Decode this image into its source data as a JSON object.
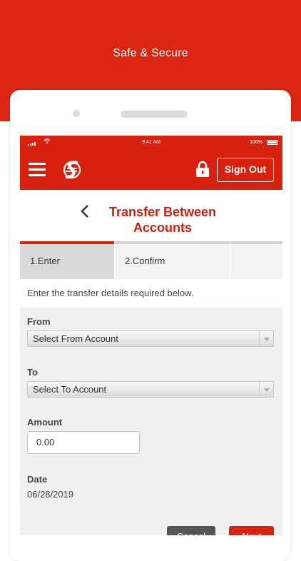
{
  "banner": {
    "tagline": "Safe & Secure"
  },
  "status_bar": {
    "time": "9:41 AM",
    "battery": "100%"
  },
  "app_bar": {
    "sign_out_label": "Sign Out"
  },
  "page": {
    "title_line1": "Transfer Between",
    "title_line2": "Accounts"
  },
  "steps": [
    {
      "label": "1.Enter",
      "active": true
    },
    {
      "label": "2.Confirm",
      "active": false
    },
    {
      "label": "",
      "active": false
    }
  ],
  "form": {
    "instructions": "Enter the transfer details required below.",
    "from_label": "From",
    "from_value": "Select From Account",
    "to_label": "To",
    "to_value": "Select To Account",
    "amount_label": "Amount",
    "amount_value": "0.00",
    "date_label": "Date",
    "date_value": "06/28/2019"
  },
  "actions": {
    "cancel_label": "Cancel",
    "next_label": "Next"
  },
  "colors": {
    "brand_red": "#d8220f",
    "title_red": "#c8200e",
    "cancel_gray": "#555555"
  },
  "icons": [
    "signal-icon",
    "wifi-icon",
    "battery-icon",
    "menu-icon",
    "scotiabank-logo-icon",
    "lock-icon",
    "back-chevron-icon",
    "dropdown-arrow-icon"
  ]
}
